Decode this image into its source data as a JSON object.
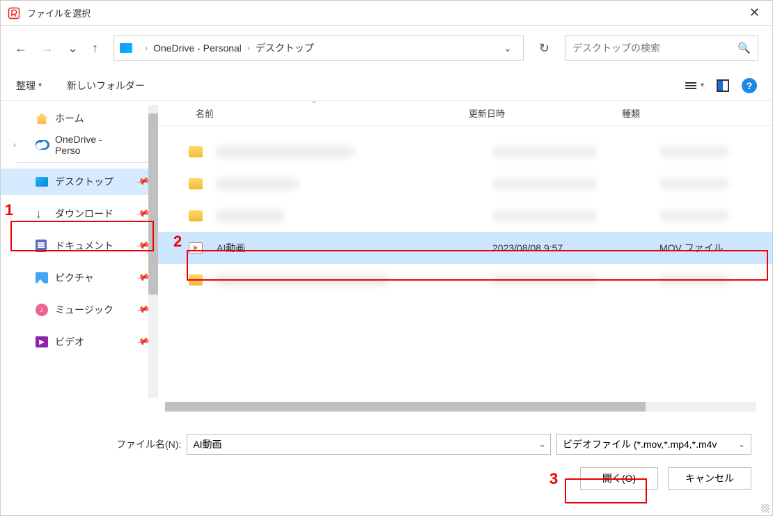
{
  "title": "ファイルを選択",
  "breadcrumb": {
    "item1": "OneDrive - Personal",
    "item2": "デスクトップ"
  },
  "search": {
    "placeholder": "デスクトップの検索"
  },
  "toolbar": {
    "organize": "整理",
    "newfolder": "新しいフォルダー"
  },
  "sidebar": {
    "home": "ホーム",
    "onedrive": "OneDrive - Perso",
    "desktop": "デスクトップ",
    "downloads": "ダウンロード",
    "documents": "ドキュメント",
    "pictures": "ピクチャ",
    "music": "ミュージック",
    "videos": "ビデオ"
  },
  "columns": {
    "name": "名前",
    "date": "更新日時",
    "type": "種類"
  },
  "selected_file": {
    "name": "AI動画",
    "date": "2023/08/08 9:57",
    "type": "MOV ファイル"
  },
  "bottom": {
    "filename_label": "ファイル名(N):",
    "filename_value": "AI動画",
    "filter": "ビデオファイル (*.mov,*.mp4,*.m4v",
    "open": "開く(O)",
    "cancel": "キャンセル"
  },
  "annotations": {
    "n1": "1",
    "n2": "2",
    "n3": "3"
  }
}
